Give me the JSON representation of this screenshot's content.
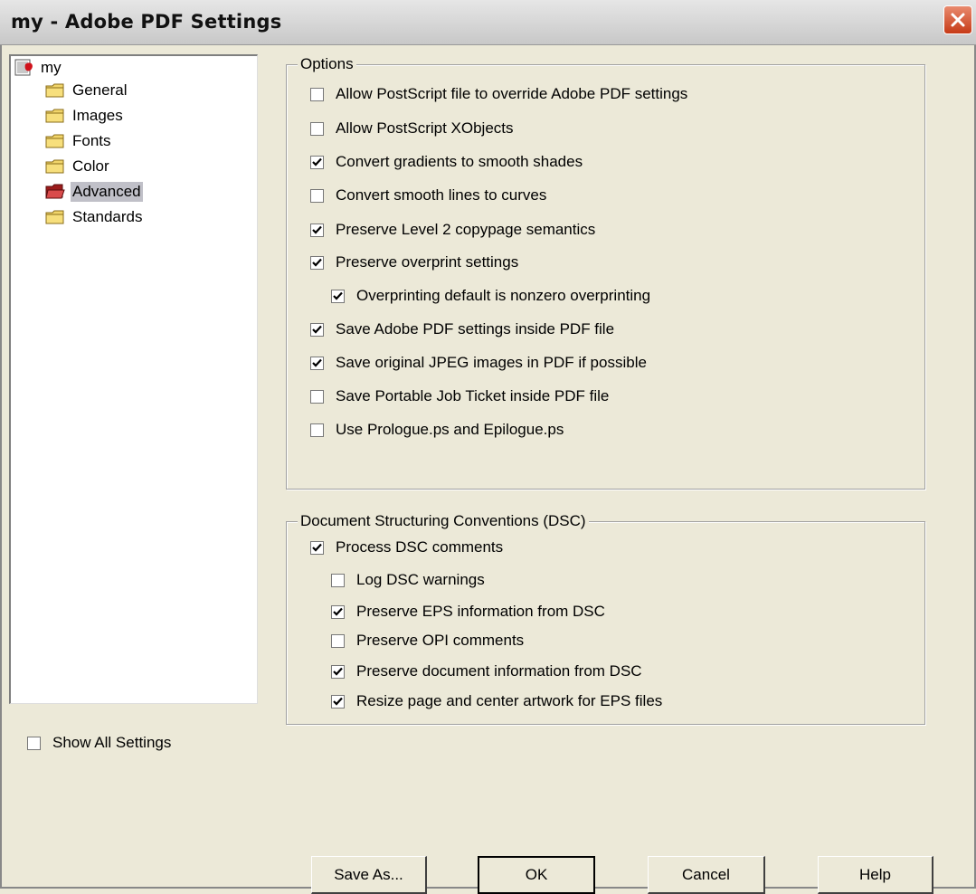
{
  "window": {
    "title": "my - Adobe PDF Settings"
  },
  "tree": {
    "root": "my",
    "items": [
      {
        "label": "General",
        "selected": false
      },
      {
        "label": "Images",
        "selected": false
      },
      {
        "label": "Fonts",
        "selected": false
      },
      {
        "label": "Color",
        "selected": false
      },
      {
        "label": "Advanced",
        "selected": true
      },
      {
        "label": "Standards",
        "selected": false
      }
    ]
  },
  "options": {
    "legend": "Options",
    "items": [
      {
        "label": "Allow PostScript file to override Adobe PDF settings",
        "checked": false
      },
      {
        "label": "Allow PostScript XObjects",
        "checked": false
      },
      {
        "label": "Convert gradients to smooth shades",
        "checked": true
      },
      {
        "label": "Convert smooth lines to curves",
        "checked": false
      },
      {
        "label": "Preserve Level 2 copypage semantics",
        "checked": true
      },
      {
        "label": "Preserve overprint settings",
        "checked": true
      },
      {
        "label": "Overprinting default is nonzero overprinting",
        "checked": true
      },
      {
        "label": "Save Adobe PDF settings inside PDF file",
        "checked": true
      },
      {
        "label": "Save original JPEG images in PDF if possible",
        "checked": true
      },
      {
        "label": "Save Portable Job Ticket inside PDF file",
        "checked": false
      },
      {
        "label": "Use Prologue.ps and Epilogue.ps",
        "checked": false
      }
    ]
  },
  "dsc": {
    "legend": "Document Structuring Conventions (DSC)",
    "items": [
      {
        "label": "Process DSC comments",
        "checked": true
      },
      {
        "label": "Log DSC warnings",
        "checked": false
      },
      {
        "label": "Preserve EPS information from DSC",
        "checked": true
      },
      {
        "label": "Preserve OPI comments",
        "checked": false
      },
      {
        "label": "Preserve document information from DSC",
        "checked": true
      },
      {
        "label": "Resize page and center artwork for EPS files",
        "checked": true
      }
    ]
  },
  "show_all": {
    "label": "Show All Settings",
    "checked": false
  },
  "buttons": {
    "save_as": "Save As...",
    "ok": "OK",
    "cancel": "Cancel",
    "help": "Help"
  },
  "colors": {
    "dialog_bg": "#ece9d8",
    "close_button": "#c63a17",
    "selection": "#c0c0c8"
  }
}
